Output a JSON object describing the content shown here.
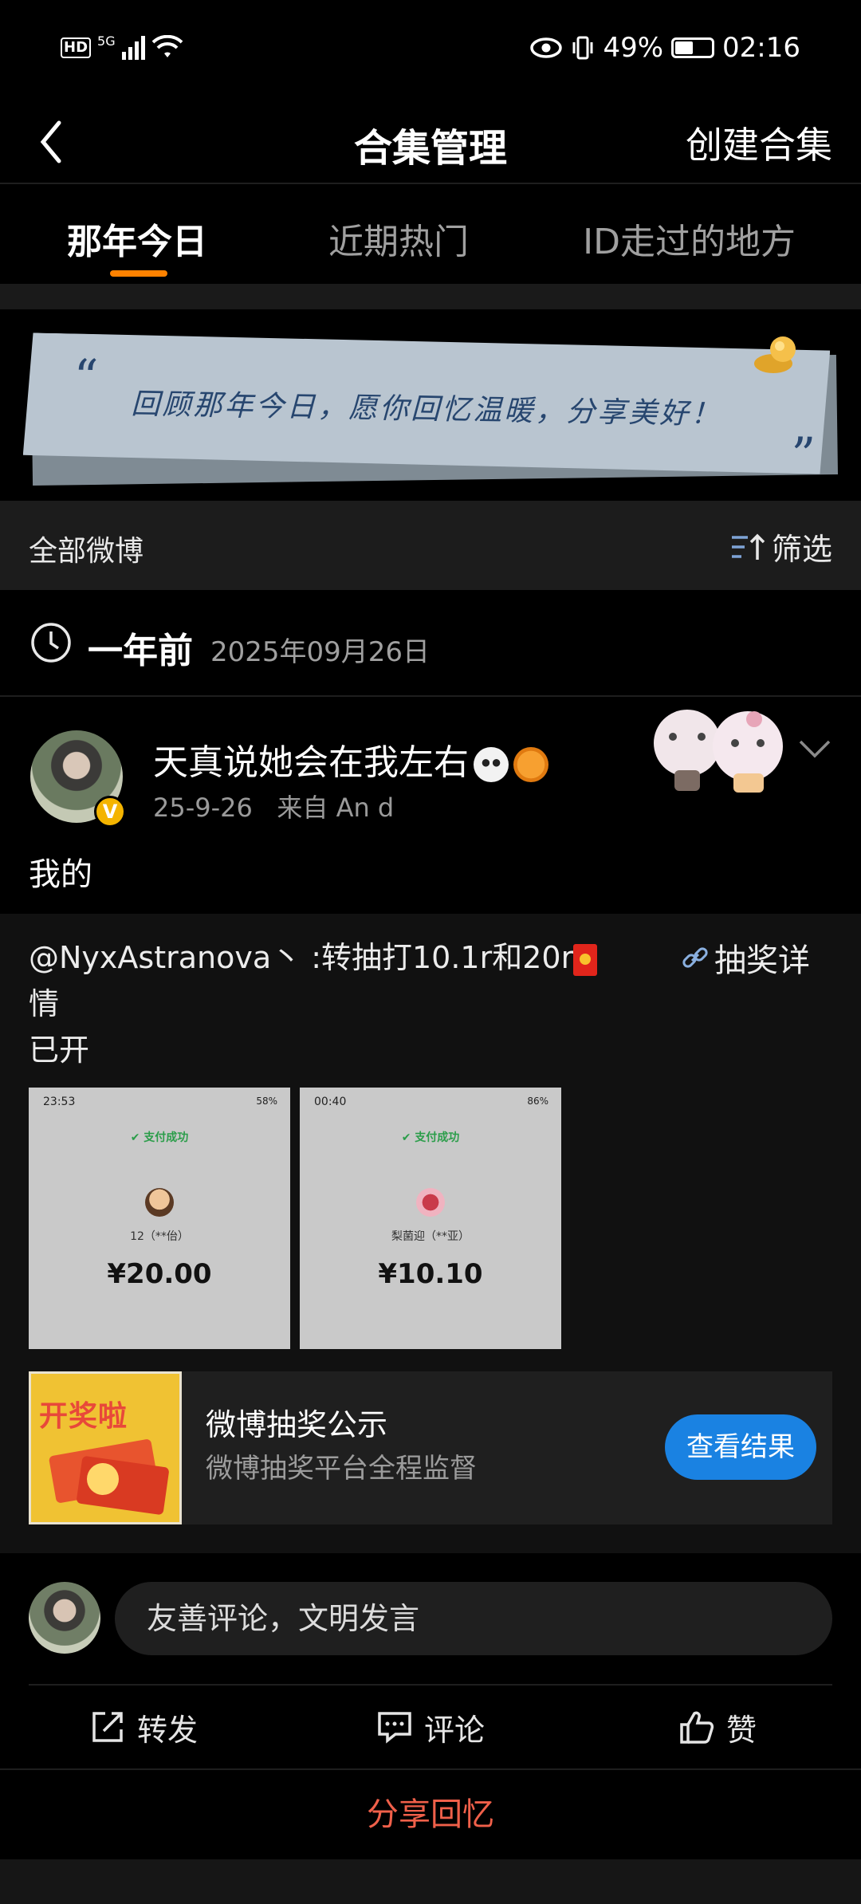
{
  "status": {
    "time": "02:16",
    "battery": "49%",
    "net": "5G",
    "hd": "HD"
  },
  "nav": {
    "title": "合集管理",
    "create": "创建合集"
  },
  "tabs": [
    {
      "label": "那年今日",
      "active": true
    },
    {
      "label": "近期热门",
      "active": false
    },
    {
      "label": "ID走过的地方",
      "active": false
    }
  ],
  "banner": {
    "text": "回顾那年今日，愿你回忆温暖，分享美好！",
    "quote_open": "“",
    "quote_close": "”"
  },
  "filter": {
    "all_label": "全部微博",
    "filter_label": "筛选"
  },
  "date_header": {
    "relative": "一年前",
    "date": "2025年09月26日"
  },
  "post": {
    "username": "天真说她会在我左右",
    "time": "25-9-26",
    "source": "来自 An       d",
    "text": "我的",
    "repost": {
      "line1": "@NyxAstranova丶 :转抽打10.1r和20r",
      "line2": "情",
      "line3": "已开",
      "lottery_link": "抽奖详",
      "images": [
        {
          "time": "23:53",
          "status": "58%",
          "pay_label": "支付成功",
          "name": "12（**佁）",
          "amount": "¥20.00"
        },
        {
          "time": "00:40",
          "status": "86%",
          "pay_label": "支付成功",
          "name": "梨菌迎（**亚）",
          "amount": "¥10.10"
        }
      ],
      "card": {
        "image_text": "开奖啦",
        "title": "微博抽奖公示",
        "subtitle": "微博抽奖平台全程监督",
        "button": "查看结果"
      }
    }
  },
  "comment": {
    "placeholder": "友善评论，文明发言"
  },
  "actions": {
    "repost": "转发",
    "comment": "评论",
    "like": "赞"
  },
  "share": "分享回忆",
  "colors": {
    "accent": "#ff8200",
    "button_blue": "#1a82e2",
    "share_red": "#f0604a"
  }
}
